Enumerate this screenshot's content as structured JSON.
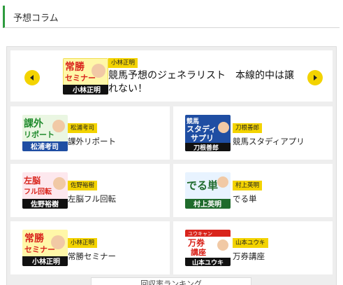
{
  "section": {
    "title": "予想コラム"
  },
  "colors": {
    "accent_green": "#2e9b3e",
    "badge_yellow": "#f3d300",
    "thumb_red": "#d9241c",
    "thumb_blue": "#1f4ea3"
  },
  "featured": {
    "author": "小林正明",
    "title": "競馬予想のジェネラリスト　本線的中は譲れない！",
    "thumb_text": [
      "常勝",
      "セミナー",
      "小林正明"
    ],
    "prev_icon": "chevron-left-icon",
    "next_icon": "chevron-right-icon"
  },
  "columns": [
    {
      "author": "松浦考司",
      "title": "課外リポート",
      "thumb_text": [
        "課外",
        "リポート",
        "松浦考司"
      ]
    },
    {
      "author": "刀根善郎",
      "title": "競馬スタディアプリ",
      "thumb_text": [
        "競馬",
        "スタディ",
        "サプリ",
        "刀根善郎"
      ]
    },
    {
      "author": "佐野裕樹",
      "title": "左脳フル回転",
      "thumb_text": [
        "左脳",
        "フル回転",
        "佐野裕樹"
      ]
    },
    {
      "author": "村上英明",
      "title": "でる単",
      "thumb_text": [
        "でる単",
        "村上英明"
      ]
    },
    {
      "author": "小林正明",
      "title": "常勝セミナー",
      "thumb_text": [
        "常勝",
        "セミナー",
        "小林正明"
      ]
    },
    {
      "author": "山本ユウキ",
      "title": "万券講座",
      "thumb_text": [
        "ユウキャン",
        "万券",
        "講座",
        "山本ユウキ"
      ]
    }
  ],
  "bottom_tab": {
    "label": "回収率ランキング"
  }
}
